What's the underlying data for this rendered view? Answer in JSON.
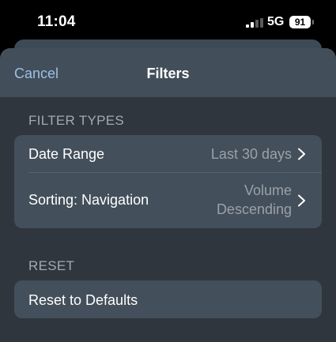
{
  "status_bar": {
    "time": "11:04",
    "network": "5G",
    "battery": "91"
  },
  "nav": {
    "cancel_label": "Cancel",
    "title": "Filters"
  },
  "sections": {
    "filter_types": {
      "header": "FILTER TYPES",
      "rows": [
        {
          "label": "Date Range",
          "value": "Last 30 days"
        },
        {
          "label": "Sorting: Navigation",
          "value_line1": "Volume",
          "value_line2": "Descending"
        }
      ]
    },
    "reset": {
      "header": "RESET",
      "rows": [
        {
          "label": "Reset to Defaults"
        }
      ]
    }
  },
  "colors": {
    "accent": "#9cc0e6",
    "sheet_background": "#2f363d",
    "group_background": "#434f5a",
    "nav_background": "#424e59"
  },
  "icons": [
    "signal-icon",
    "battery-icon",
    "chevron-right-icon"
  ]
}
